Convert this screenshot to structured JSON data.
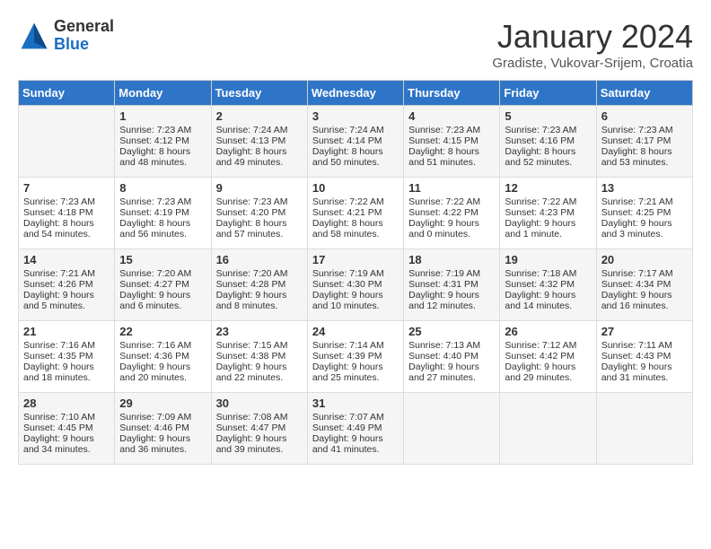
{
  "header": {
    "logo": {
      "general": "General",
      "blue": "Blue"
    },
    "title": "January 2024",
    "subtitle": "Gradiste, Vukovar-Srijem, Croatia"
  },
  "weekdays": [
    "Sunday",
    "Monday",
    "Tuesday",
    "Wednesday",
    "Thursday",
    "Friday",
    "Saturday"
  ],
  "weeks": [
    [
      {
        "day": "",
        "sunrise": "",
        "sunset": "",
        "daylight": ""
      },
      {
        "day": "1",
        "sunrise": "Sunrise: 7:23 AM",
        "sunset": "Sunset: 4:12 PM",
        "daylight": "Daylight: 8 hours and 48 minutes."
      },
      {
        "day": "2",
        "sunrise": "Sunrise: 7:24 AM",
        "sunset": "Sunset: 4:13 PM",
        "daylight": "Daylight: 8 hours and 49 minutes."
      },
      {
        "day": "3",
        "sunrise": "Sunrise: 7:24 AM",
        "sunset": "Sunset: 4:14 PM",
        "daylight": "Daylight: 8 hours and 50 minutes."
      },
      {
        "day": "4",
        "sunrise": "Sunrise: 7:23 AM",
        "sunset": "Sunset: 4:15 PM",
        "daylight": "Daylight: 8 hours and 51 minutes."
      },
      {
        "day": "5",
        "sunrise": "Sunrise: 7:23 AM",
        "sunset": "Sunset: 4:16 PM",
        "daylight": "Daylight: 8 hours and 52 minutes."
      },
      {
        "day": "6",
        "sunrise": "Sunrise: 7:23 AM",
        "sunset": "Sunset: 4:17 PM",
        "daylight": "Daylight: 8 hours and 53 minutes."
      }
    ],
    [
      {
        "day": "7",
        "sunrise": "Sunrise: 7:23 AM",
        "sunset": "Sunset: 4:18 PM",
        "daylight": "Daylight: 8 hours and 54 minutes."
      },
      {
        "day": "8",
        "sunrise": "Sunrise: 7:23 AM",
        "sunset": "Sunset: 4:19 PM",
        "daylight": "Daylight: 8 hours and 56 minutes."
      },
      {
        "day": "9",
        "sunrise": "Sunrise: 7:23 AM",
        "sunset": "Sunset: 4:20 PM",
        "daylight": "Daylight: 8 hours and 57 minutes."
      },
      {
        "day": "10",
        "sunrise": "Sunrise: 7:22 AM",
        "sunset": "Sunset: 4:21 PM",
        "daylight": "Daylight: 8 hours and 58 minutes."
      },
      {
        "day": "11",
        "sunrise": "Sunrise: 7:22 AM",
        "sunset": "Sunset: 4:22 PM",
        "daylight": "Daylight: 9 hours and 0 minutes."
      },
      {
        "day": "12",
        "sunrise": "Sunrise: 7:22 AM",
        "sunset": "Sunset: 4:23 PM",
        "daylight": "Daylight: 9 hours and 1 minute."
      },
      {
        "day": "13",
        "sunrise": "Sunrise: 7:21 AM",
        "sunset": "Sunset: 4:25 PM",
        "daylight": "Daylight: 9 hours and 3 minutes."
      }
    ],
    [
      {
        "day": "14",
        "sunrise": "Sunrise: 7:21 AM",
        "sunset": "Sunset: 4:26 PM",
        "daylight": "Daylight: 9 hours and 5 minutes."
      },
      {
        "day": "15",
        "sunrise": "Sunrise: 7:20 AM",
        "sunset": "Sunset: 4:27 PM",
        "daylight": "Daylight: 9 hours and 6 minutes."
      },
      {
        "day": "16",
        "sunrise": "Sunrise: 7:20 AM",
        "sunset": "Sunset: 4:28 PM",
        "daylight": "Daylight: 9 hours and 8 minutes."
      },
      {
        "day": "17",
        "sunrise": "Sunrise: 7:19 AM",
        "sunset": "Sunset: 4:30 PM",
        "daylight": "Daylight: 9 hours and 10 minutes."
      },
      {
        "day": "18",
        "sunrise": "Sunrise: 7:19 AM",
        "sunset": "Sunset: 4:31 PM",
        "daylight": "Daylight: 9 hours and 12 minutes."
      },
      {
        "day": "19",
        "sunrise": "Sunrise: 7:18 AM",
        "sunset": "Sunset: 4:32 PM",
        "daylight": "Daylight: 9 hours and 14 minutes."
      },
      {
        "day": "20",
        "sunrise": "Sunrise: 7:17 AM",
        "sunset": "Sunset: 4:34 PM",
        "daylight": "Daylight: 9 hours and 16 minutes."
      }
    ],
    [
      {
        "day": "21",
        "sunrise": "Sunrise: 7:16 AM",
        "sunset": "Sunset: 4:35 PM",
        "daylight": "Daylight: 9 hours and 18 minutes."
      },
      {
        "day": "22",
        "sunrise": "Sunrise: 7:16 AM",
        "sunset": "Sunset: 4:36 PM",
        "daylight": "Daylight: 9 hours and 20 minutes."
      },
      {
        "day": "23",
        "sunrise": "Sunrise: 7:15 AM",
        "sunset": "Sunset: 4:38 PM",
        "daylight": "Daylight: 9 hours and 22 minutes."
      },
      {
        "day": "24",
        "sunrise": "Sunrise: 7:14 AM",
        "sunset": "Sunset: 4:39 PM",
        "daylight": "Daylight: 9 hours and 25 minutes."
      },
      {
        "day": "25",
        "sunrise": "Sunrise: 7:13 AM",
        "sunset": "Sunset: 4:40 PM",
        "daylight": "Daylight: 9 hours and 27 minutes."
      },
      {
        "day": "26",
        "sunrise": "Sunrise: 7:12 AM",
        "sunset": "Sunset: 4:42 PM",
        "daylight": "Daylight: 9 hours and 29 minutes."
      },
      {
        "day": "27",
        "sunrise": "Sunrise: 7:11 AM",
        "sunset": "Sunset: 4:43 PM",
        "daylight": "Daylight: 9 hours and 31 minutes."
      }
    ],
    [
      {
        "day": "28",
        "sunrise": "Sunrise: 7:10 AM",
        "sunset": "Sunset: 4:45 PM",
        "daylight": "Daylight: 9 hours and 34 minutes."
      },
      {
        "day": "29",
        "sunrise": "Sunrise: 7:09 AM",
        "sunset": "Sunset: 4:46 PM",
        "daylight": "Daylight: 9 hours and 36 minutes."
      },
      {
        "day": "30",
        "sunrise": "Sunrise: 7:08 AM",
        "sunset": "Sunset: 4:47 PM",
        "daylight": "Daylight: 9 hours and 39 minutes."
      },
      {
        "day": "31",
        "sunrise": "Sunrise: 7:07 AM",
        "sunset": "Sunset: 4:49 PM",
        "daylight": "Daylight: 9 hours and 41 minutes."
      },
      {
        "day": "",
        "sunrise": "",
        "sunset": "",
        "daylight": ""
      },
      {
        "day": "",
        "sunrise": "",
        "sunset": "",
        "daylight": ""
      },
      {
        "day": "",
        "sunrise": "",
        "sunset": "",
        "daylight": ""
      }
    ]
  ]
}
